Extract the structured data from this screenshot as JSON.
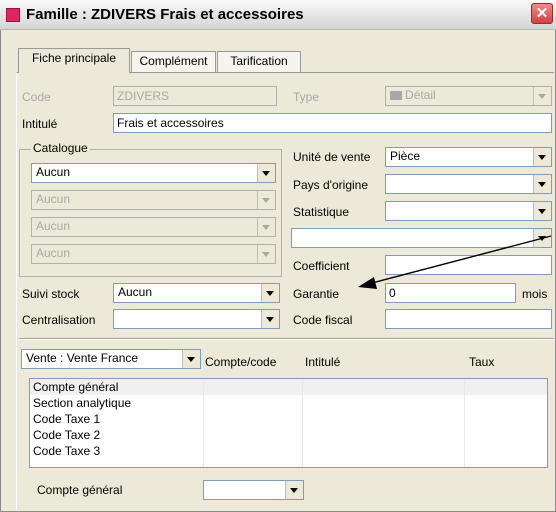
{
  "window": {
    "title": "Famille : ZDIVERS Frais et accessoires",
    "close_glyph": "✕"
  },
  "tabs": [
    "Fiche principale",
    "Complément",
    "Tarification"
  ],
  "form": {
    "code_label": "Code",
    "code_value": "ZDIVERS",
    "type_label": "Type",
    "type_value": "Détail",
    "intitule_label": "Intitulé",
    "intitule_value": "Frais et accessoires",
    "catalogue_title": "Catalogue",
    "catalogue_values": [
      "Aucun",
      "Aucun",
      "Aucun",
      "Aucun"
    ],
    "unite_label": "Unité de vente",
    "unite_value": "Pièce",
    "pays_label": "Pays d'origine",
    "pays_value": "",
    "statistique_label": "Statistique",
    "statistique_value": "",
    "extra_value": "",
    "coefficient_label": "Coefficient",
    "coefficient_value": "",
    "garantie_label": "Garantie",
    "garantie_value": "0",
    "garantie_unit": "mois",
    "suivi_label": "Suivi stock",
    "suivi_value": "Aucun",
    "centralisation_label": "Centralisation",
    "centralisation_value": "",
    "code_fiscal_label": "Code fiscal",
    "code_fiscal_value": ""
  },
  "accounts": {
    "mode_value": "Vente : Vente France",
    "columns": [
      "Compte/code",
      "Intitulé",
      "Taux"
    ],
    "rows": [
      "Compte général",
      "Section analytique",
      "Code Taxe 1",
      "Code Taxe 2",
      "Code Taxe 3"
    ],
    "footer_label": "Compte général",
    "footer_value": ""
  },
  "colors": {
    "title_icon": "#e0245e",
    "close": "#d64040",
    "arrow": "#000000"
  }
}
